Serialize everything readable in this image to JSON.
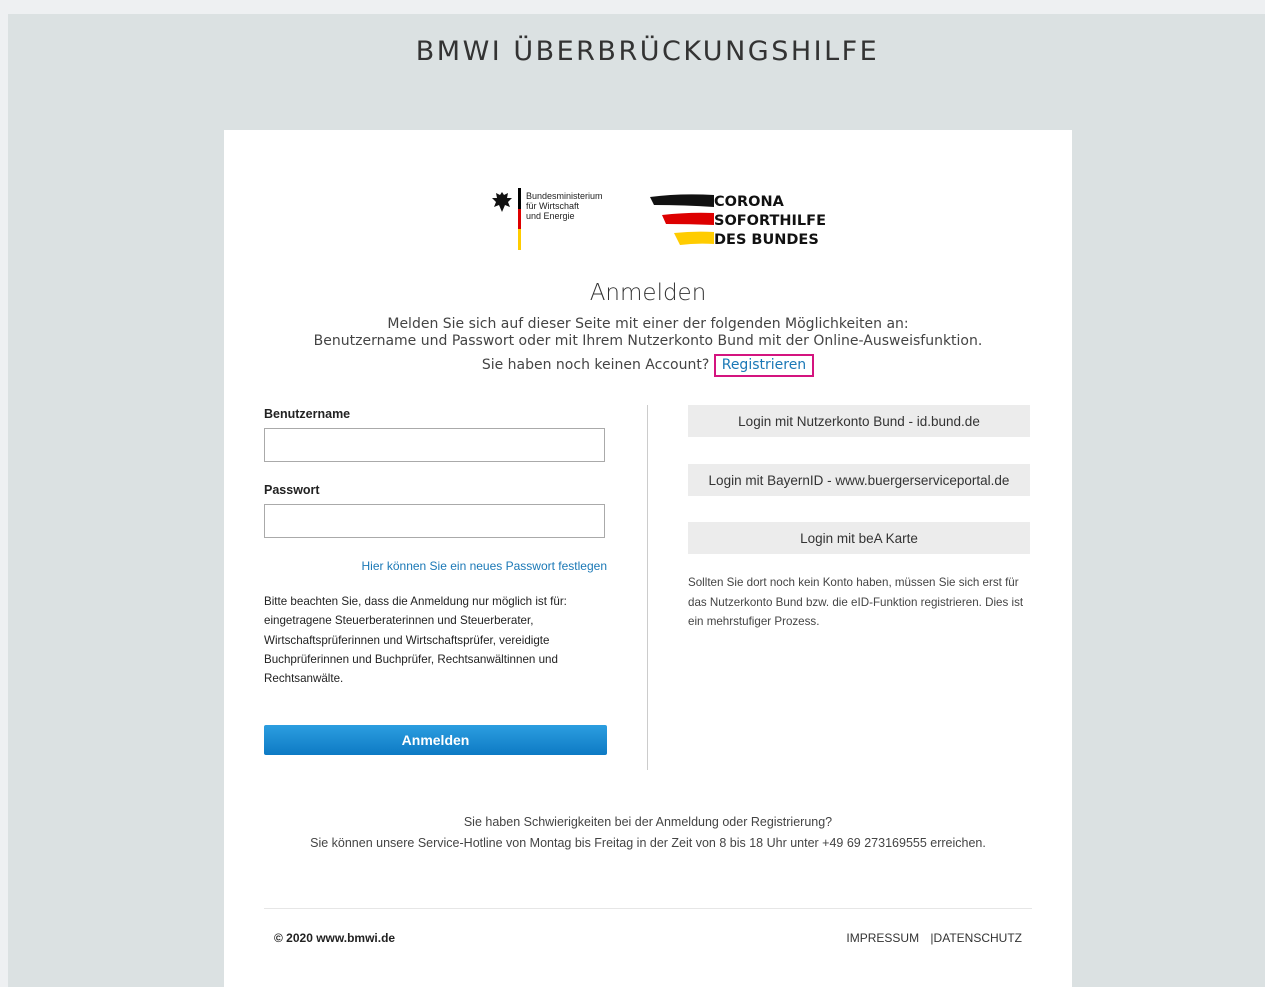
{
  "site_title": "BMWI ÜBERBRÜCKUNGSHILFE",
  "logos": {
    "ministry_lines": "Bundesministerium\nfür Wirtschaft\nund Energie",
    "corona_line1": "CORONA",
    "corona_line2": "SOFORTHILFE",
    "corona_line3": "DES BUNDES"
  },
  "login": {
    "heading": "Anmelden",
    "intro_line1": "Melden Sie sich auf dieser Seite mit einer der folgenden Möglichkeiten an:",
    "intro_line2": "Benutzername und Passwort oder mit Ihrem Nutzerkonto Bund mit der Online-Ausweisfunktion.",
    "no_account_text": "Sie haben noch keinen Account?",
    "register_link": "Registrieren",
    "username_label": "Benutzername",
    "username_value": "",
    "password_label": "Passwort",
    "password_value": "",
    "forgot_password_link": "Hier können Sie ein neues Passwort festlegen",
    "notice": "Bitte beachten Sie, dass die Anmeldung nur möglich ist für: eingetragene Steuerberaterinnen und Steuerberater, Wirtschaftsprüferinnen und Wirtschaftsprüfer, vereidigte Buchprüferinnen und Buchprüfer, Rechtsanwältinnen und Rechtsanwälte.",
    "submit_label": "Anmelden"
  },
  "external_logins": [
    {
      "label": "Login mit Nutzerkonto Bund - id.bund.de"
    },
    {
      "label": "Login mit BayernID - www.buergerserviceportal.de"
    },
    {
      "label": "Login mit beA Karte"
    }
  ],
  "external_note": "Sollten Sie dort noch kein Konto haben, müssen Sie sich erst für das Nutzerkonto Bund bzw. die eID-Funktion registrieren. Dies ist ein mehrstufiger Prozess.",
  "help": {
    "line1": "Sie haben Schwierigkeiten bei der Anmeldung oder Registrierung?",
    "line2": "Sie können unsere Service-Hotline von Montag bis Freitag in der Zeit von 8 bis 18 Uhr unter +49 69 273169555 erreichen."
  },
  "footer": {
    "copyright": "© 2020 www.bmwi.de",
    "impressum": "IMPRESSUM",
    "separator": "|",
    "datenschutz": "DATENSCHUTZ"
  },
  "colors": {
    "page_bg": "#dbe1e2",
    "card_bg": "#ffffff",
    "link": "#1a78b6",
    "highlight_border": "#d4147f",
    "primary_button": "#1384cf",
    "flag_black": "#000000",
    "flag_red": "#dd0000",
    "flag_gold": "#ffcc00"
  }
}
